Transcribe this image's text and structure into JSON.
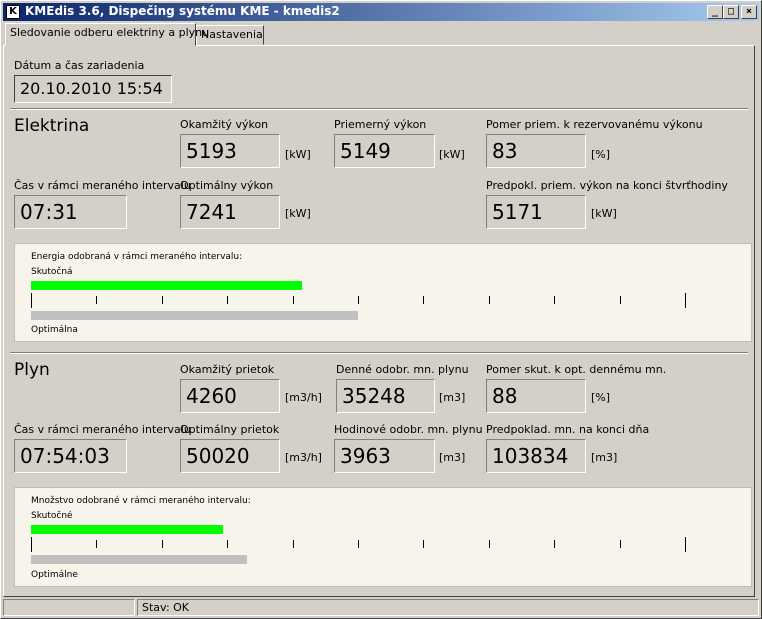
{
  "window": {
    "icon_text": "K",
    "title": "KMEdis 3.6, Dispečing systému KME - kmedis2",
    "minimize_glyph": "_",
    "maximize_glyph": "□",
    "close_glyph": "×"
  },
  "tabs": [
    {
      "label": "Sledovanie odberu elektriny a plynu",
      "active": true
    },
    {
      "label": "Nastavenia",
      "active": false
    }
  ],
  "device_time": {
    "label": "Dátum a čas zariadenia",
    "value": "20.10.2010 15:54"
  },
  "electricity": {
    "heading": "Elektrina",
    "interval_time_label": "Čas v rámci meraného intervalu",
    "interval_time": "07:31",
    "instant_power": {
      "label": "Okamžitý výkon",
      "value": "5193",
      "unit": "[kW]"
    },
    "average_power": {
      "label": "Priemerný výkon",
      "value": "5149",
      "unit": "[kW]"
    },
    "ratio_reserved": {
      "label": "Pomer priem. k rezervovanému výkonu",
      "value": "83",
      "unit": "[%]"
    },
    "optimal_power": {
      "label": "Optimálny výkon",
      "value": "7241",
      "unit": "[kW]"
    },
    "predicted_power": {
      "label": "Predpokl. priem. výkon na konci štvrťhodiny",
      "value": "5171",
      "unit": "[kW]"
    },
    "gauge": {
      "title": "Energia odobraná v rámci meraného intervalu:",
      "actual_label": "Skutočná",
      "optimal_label": "Optimálna",
      "actual_fraction": 0.415,
      "optimal_fraction": 0.5,
      "actual_color": "#00ff00",
      "optimal_color": "#c0c0c0"
    }
  },
  "gas": {
    "heading": "Plyn",
    "interval_time_label": "Čas v rámci meraného intervalu",
    "interval_time": "07:54:03",
    "instant_flow": {
      "label": "Okamžitý prietok",
      "value": "4260",
      "unit": "[m3/h]"
    },
    "daily_draw": {
      "label": "Denné odobr. mn. plynu",
      "value": "35248",
      "unit": "[m3]"
    },
    "ratio_daily": {
      "label": "Pomer skut. k opt. dennému mn.",
      "value": "88",
      "unit": "[%]"
    },
    "optimal_flow": {
      "label": "Optimálny prietok",
      "value": "50020",
      "unit": "[m3/h]"
    },
    "hourly_draw": {
      "label": "Hodinové odobr. mn. plynu",
      "value": "3963",
      "unit": "[m3]"
    },
    "predicted_daily": {
      "label": "Predpoklad. mn. na konci dňa",
      "value": "103834",
      "unit": "[m3]"
    },
    "gauge": {
      "title": "Množstvo odobrané v rámci meraného intervalu:",
      "actual_label": "Skutočné",
      "optimal_label": "Optimálne",
      "actual_fraction": 0.293,
      "optimal_fraction": 0.33,
      "actual_color": "#00ff00",
      "optimal_color": "#c0c0c0"
    }
  },
  "statusbar": {
    "left": "",
    "status": "Stav: OK"
  }
}
